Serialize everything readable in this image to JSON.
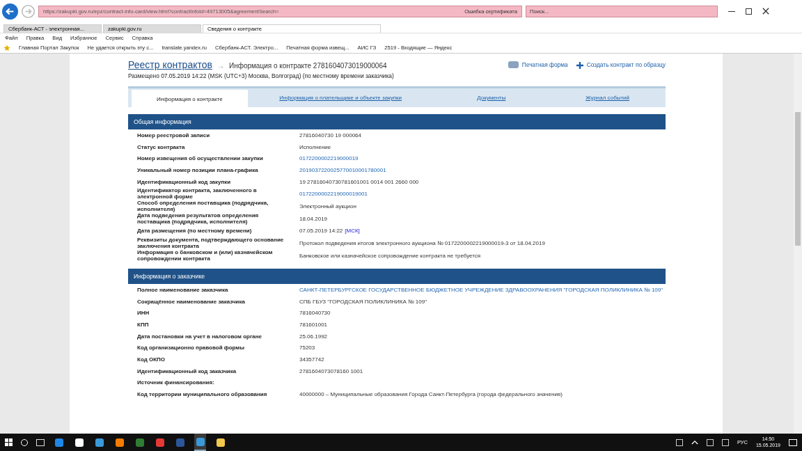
{
  "browser": {
    "url": "https://zakupki.gov.ru/epz/contract-info-card/view.html?contractInfoId=49713005&agreementSearch=",
    "cert_error": "Ошибка сертификата",
    "search": {
      "placeholder": "Поиск..."
    },
    "tabs": [
      {
        "label": "Сбербанк-АСТ - электронная...",
        "selected": false
      },
      {
        "label": "zakupki.gov.ru",
        "selected": false
      },
      {
        "label": "Сведения о контракте",
        "selected": true
      }
    ],
    "menu": [
      "Файл",
      "Правка",
      "Вид",
      "Избранное",
      "Сервис",
      "Справка"
    ],
    "favorites": [
      "Главная Портал Закупок",
      "Не удается открыть эту с...",
      "translate.yandex.ru",
      "Сбербанк-АСТ. Электро...",
      "Печатная форма извещ...",
      "АИС ГЗ",
      "2519 - Входящие — Яндекс"
    ]
  },
  "page": {
    "breadcrumb": "Реестр контрактов",
    "arrow": "→",
    "title": "Информация о контракте 2781604073019000064",
    "print": "Печатная форма",
    "create": "Создать контракт по образцу",
    "posted": "Размещено 07.05.2019 14:22 (MSK (UTC+3) Москва, Волгоград) (по местному времени заказчика)",
    "tabs": [
      {
        "label": "Информация о контракте",
        "selected": true
      },
      {
        "label": "Информация о плательщике и объекте закупки",
        "selected": false
      },
      {
        "label": "Документы",
        "selected": false
      },
      {
        "label": "Журнал событий",
        "selected": false
      }
    ],
    "sections": [
      {
        "title": "Общая информация",
        "rows": [
          {
            "label": "Номер реестровой записи",
            "value": "27816040730 19 000064",
            "kind": "text"
          },
          {
            "label": "Статус контракта",
            "value": "Исполнение",
            "kind": "text"
          },
          {
            "label": "Номер извещения об осуществлении закупки",
            "value": "0172200002219000019",
            "kind": "link"
          },
          {
            "label": "Уникальный номер позиции плана-графика",
            "value": "2019037220025770010001780001",
            "kind": "link"
          },
          {
            "label": "Идентификационный код закупки",
            "value": "19 27816040730781601001 0014 001 2660 000",
            "kind": "text"
          },
          {
            "label": "Идентификатор контракта, заключенного в электронной форме",
            "value": "0172200002219000019001",
            "kind": "link"
          },
          {
            "label": "Способ определения поставщика (подрядчика, исполнителя)",
            "value": "Электронный аукцион",
            "kind": "text"
          },
          {
            "label": "Дата подведения результатов определения поставщика (подрядчика, исполнителя)",
            "value": "18.04.2019",
            "kind": "text"
          },
          {
            "label": "Дата размещения (по местному времени)",
            "value": "07.05.2019 14:22",
            "suffix": "[МСК]",
            "kind": "text"
          },
          {
            "label": "Реквизиты документа, подтверждающего основание заключения контракта",
            "value": "Протокол подведения итогов электронного аукциона № 0172200002219000019-3 от 18.04.2019",
            "kind": "text"
          },
          {
            "label": "Информация о банковском и (или) казначейском сопровождении контракта",
            "value": "Банковское или казначейское сопровождение контракта не требуется",
            "kind": "text"
          }
        ]
      },
      {
        "title": "Информация о заказчике",
        "rows": [
          {
            "label": "Полное наименование заказчика",
            "value": "САНКТ-ПЕТЕРБУРГСКОЕ ГОСУДАРСТВЕННОЕ БЮДЖЕТНОЕ УЧРЕЖДЕНИЕ ЗДРАВООХРАНЕНИЯ \"ГОРОДСКАЯ ПОЛИКЛИНИКА № 109\"",
            "kind": "link"
          },
          {
            "label": "Сокращённое наименование заказчика",
            "value": "СПБ ГБУЗ \"ГОРОДСКАЯ ПОЛИКЛИНИКА № 109\"",
            "kind": "text"
          },
          {
            "label": "ИНН",
            "value": "7816040730",
            "kind": "text"
          },
          {
            "label": "КПП",
            "value": "781601001",
            "kind": "text"
          },
          {
            "label": "Дата постановки на учет в налоговом органе",
            "value": "25.06.1992",
            "kind": "text"
          },
          {
            "label": "Код организационно правовой формы",
            "value": "75203",
            "kind": "text"
          },
          {
            "label": "Код ОКПО",
            "value": "34357742",
            "kind": "text"
          },
          {
            "label": "Идентификационный код заказчика",
            "value": "2781604073078160 1001",
            "kind": "text"
          },
          {
            "label": "Источник финансирования:",
            "kind": "heading"
          },
          {
            "label": "Код территории муниципального образования",
            "value": "40000000 – Муниципальные образования Города Санкт-Петербурга (города федерального значения)",
            "kind": "text"
          }
        ]
      }
    ]
  },
  "taskbar": {
    "lang": "РУС",
    "time": "14:50",
    "date": "15.05.2019"
  }
}
